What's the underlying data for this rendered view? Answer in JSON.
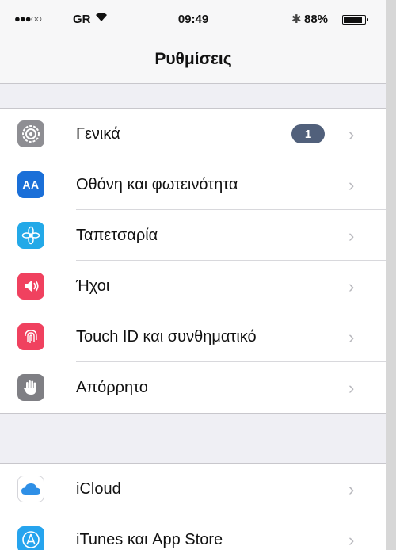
{
  "status_bar": {
    "signal": "●●●○○",
    "carrier": "GR",
    "time": "09:49",
    "battery_percent_text": "88%",
    "battery_level": 0.88
  },
  "nav": {
    "title": "Ρυθμίσεις"
  },
  "groups": [
    {
      "items": [
        {
          "label": "Γενικά",
          "icon": "gear-icon",
          "color": "#8e8e93",
          "badge": "1"
        },
        {
          "label": "Οθόνη και φωτεινότητα",
          "icon": "display-text-icon",
          "glyph": "AA",
          "color": "#1a6fd8"
        },
        {
          "label": "Ταπετσαρία",
          "icon": "wallpaper-flower-icon",
          "color": "#23a9e8"
        },
        {
          "label": "Ήχοι",
          "icon": "speaker-icon",
          "color": "#f0415f"
        },
        {
          "label": "Touch ID και συνθηματικό",
          "icon": "fingerprint-icon",
          "color": "#f0415f"
        },
        {
          "label": "Απόρρητο",
          "icon": "hand-icon",
          "color": "#7f7f84"
        }
      ]
    },
    {
      "items": [
        {
          "label": "iCloud",
          "icon": "cloud-icon",
          "color": "#ffffff"
        },
        {
          "label": "iTunes και App Store",
          "icon": "app-store-icon",
          "color": "#26a4ee"
        }
      ]
    }
  ]
}
